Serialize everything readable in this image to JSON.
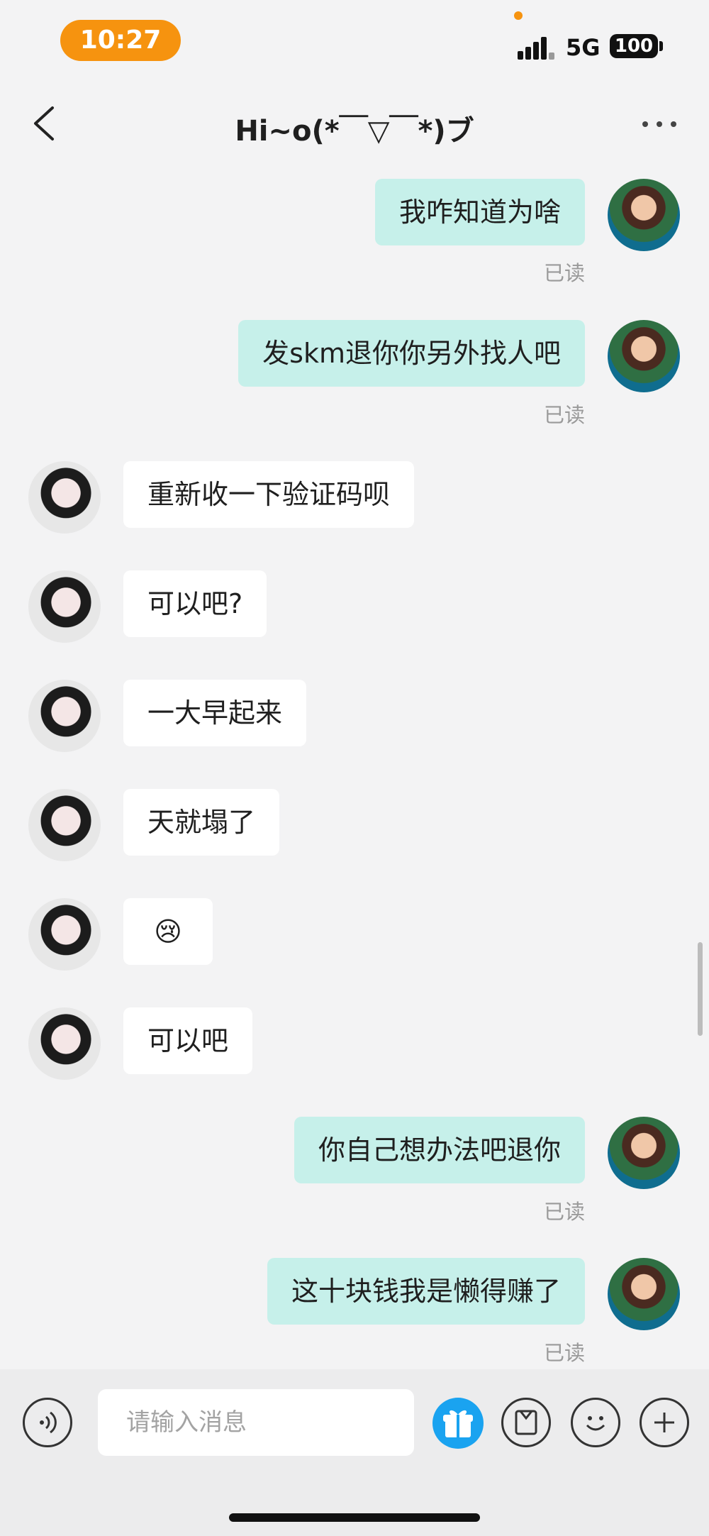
{
  "status_bar": {
    "time": "10:27",
    "network": "5G",
    "battery": "100"
  },
  "header": {
    "title": "Hi~o(*￣▽￣*)ブ"
  },
  "read_label": "已读",
  "messages": [
    {
      "from": "me",
      "text": "我咋知道为啥",
      "read": "已读"
    },
    {
      "from": "me",
      "text": "发skm退你你另外找人吧",
      "read": "已读"
    },
    {
      "from": "them",
      "text": "重新收一下验证码呗"
    },
    {
      "from": "them",
      "text": "可以吧?"
    },
    {
      "from": "them",
      "text": "一大早起来"
    },
    {
      "from": "them",
      "text": "天就塌了"
    },
    {
      "from": "them",
      "text": "😢"
    },
    {
      "from": "them",
      "text": "可以吧"
    },
    {
      "from": "me",
      "text": "你自己想办法吧退你",
      "read": "已读"
    },
    {
      "from": "me",
      "text": "这十块钱我是懒得赚了",
      "read": "已读"
    }
  ],
  "input": {
    "placeholder": "请输入消息"
  },
  "icons": {
    "back": "chevron-left-icon",
    "more": "more-icon",
    "voice": "voice-icon",
    "gift": "gift-icon",
    "card": "card-icon",
    "emoji": "emoji-icon",
    "add": "plus-icon"
  },
  "colors": {
    "accent_orange": "#f6930f",
    "my_bubble": "#c6f0ea",
    "gift_blue": "#1aa3f0"
  }
}
